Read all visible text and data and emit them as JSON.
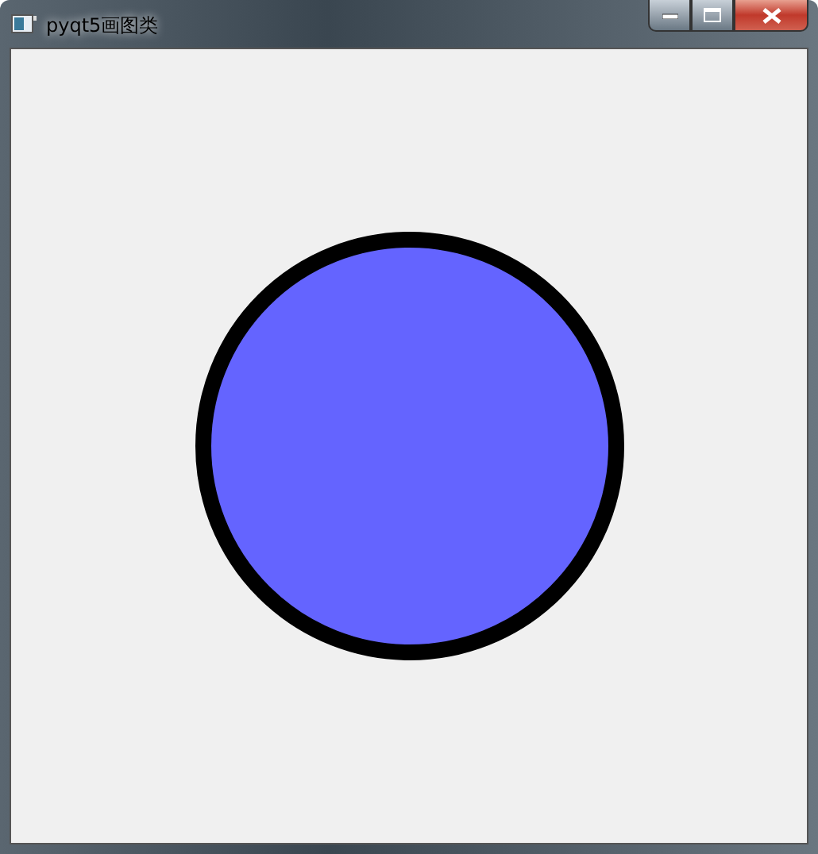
{
  "window": {
    "title": "pyqt5画图类"
  }
}
